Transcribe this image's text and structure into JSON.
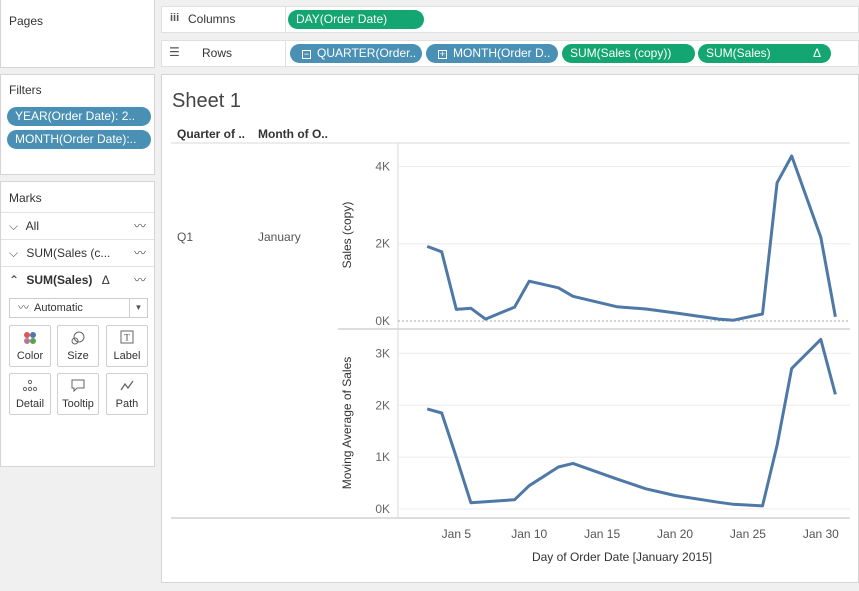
{
  "pages": {
    "title": "Pages"
  },
  "shelves": {
    "columns_label": "Columns",
    "rows_label": "Rows",
    "columns": [
      {
        "label": "DAY(Order Date)"
      }
    ],
    "rows": [
      {
        "label": "QUARTER(Order.."
      },
      {
        "label": "MONTH(Order D.."
      },
      {
        "label": "SUM(Sales (copy))"
      },
      {
        "label": "SUM(Sales)",
        "delta": "Δ"
      }
    ]
  },
  "filters": {
    "title": "Filters",
    "items": [
      {
        "label": "YEAR(Order Date): 2.."
      },
      {
        "label": "MONTH(Order Date):.."
      }
    ]
  },
  "marks": {
    "title": "Marks",
    "rows": [
      {
        "label": "All"
      },
      {
        "label": "SUM(Sales (c..."
      },
      {
        "label": "SUM(Sales)",
        "delta": "Δ"
      }
    ],
    "mark_type": "Automatic",
    "cards": [
      {
        "label": "Color",
        "icon": "color-dots-icon"
      },
      {
        "label": "Size",
        "icon": "size-icon"
      },
      {
        "label": "Label",
        "icon": "label-icon"
      },
      {
        "label": "Detail",
        "icon": "detail-icon"
      },
      {
        "label": "Tooltip",
        "icon": "tooltip-icon"
      },
      {
        "label": "Path",
        "icon": "path-icon"
      }
    ]
  },
  "sheet": {
    "title": "Sheet 1",
    "headers": {
      "quarter": "Quarter of ..",
      "month": "Month of O.."
    },
    "row": {
      "quarter": "Q1",
      "month": "January"
    }
  },
  "colors": {
    "line": "#4e79a7",
    "green_pill": "#13a672",
    "blue_pill": "#4a90b4"
  },
  "chart_data": [
    {
      "type": "line",
      "ylabel": "Sales (copy)",
      "xlabel": "Day of Order Date [January 2015]",
      "ylim": [
        0,
        4400
      ],
      "yticks": [
        "0K",
        "2K",
        "4K"
      ],
      "ytick_values": [
        0,
        2000,
        4000
      ],
      "x": [
        3,
        4,
        5,
        6,
        7,
        9,
        10,
        12,
        13,
        16,
        18,
        20,
        23,
        24,
        26,
        27,
        28,
        30,
        31
      ],
      "values": [
        1930,
        1790,
        300,
        330,
        50,
        360,
        1030,
        860,
        640,
        370,
        310,
        210,
        50,
        20,
        180,
        3580,
        4270,
        2170,
        110
      ]
    },
    {
      "type": "line",
      "ylabel": "Moving Average of Sales",
      "xlabel": "Day of Order Date [January 2015]",
      "ylim": [
        0,
        3200
      ],
      "yticks": [
        "0K",
        "1K",
        "2K",
        "3K"
      ],
      "ytick_values": [
        0,
        1000,
        2000,
        3000
      ],
      "x": [
        3,
        4,
        5,
        6,
        7,
        9,
        10,
        12,
        13,
        16,
        18,
        20,
        23,
        24,
        26,
        27,
        28,
        30,
        31
      ],
      "values": [
        1930,
        1850,
        1000,
        120,
        140,
        180,
        450,
        810,
        880,
        580,
        390,
        260,
        130,
        90,
        60,
        1230,
        2710,
        3270,
        2210
      ]
    }
  ],
  "x_axis": {
    "ticks": [
      "Jan 5",
      "Jan 10",
      "Jan 15",
      "Jan 20",
      "Jan 25",
      "Jan 30"
    ],
    "tick_values": [
      5,
      10,
      15,
      20,
      25,
      30
    ],
    "range": [
      1,
      32
    ]
  }
}
